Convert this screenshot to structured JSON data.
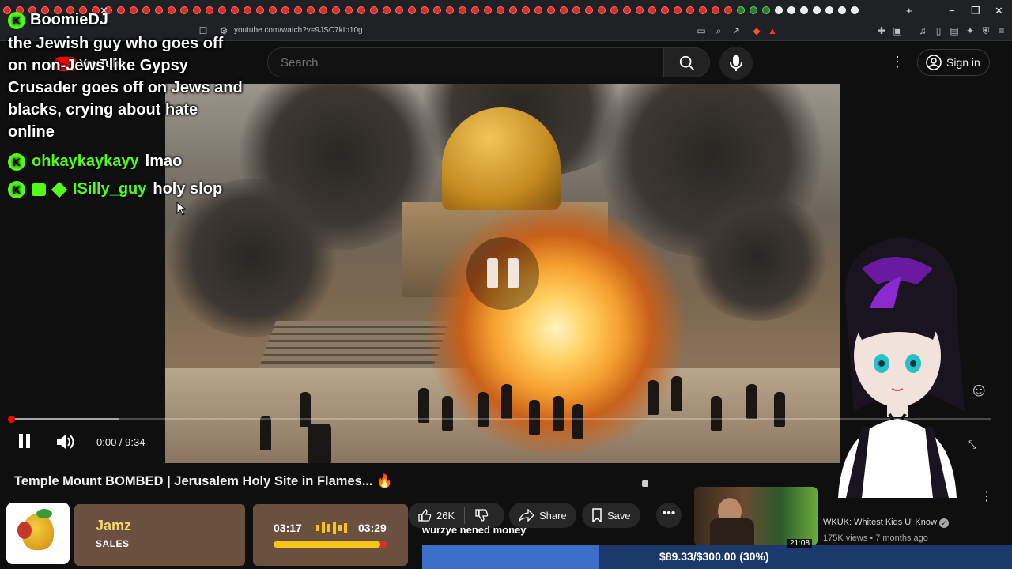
{
  "browser": {
    "url": "youtube.com/watch?v=9JSC7kIp10g",
    "close_tab": "✕",
    "new_tab": "+",
    "window_controls": {
      "minimize": "−",
      "maximize": "❐",
      "close": "✕"
    }
  },
  "youtube": {
    "logo_text": "YouTube",
    "search": {
      "placeholder": "Search"
    },
    "signin_label": "Sign in",
    "video": {
      "title": "Temple Mount BOMBED | Jerusalem Holy Site in Flames... 🔥",
      "time_display": "0:00 / 9:34",
      "progress_fraction": 0.0,
      "state": "paused"
    },
    "actions": {
      "likes": "26K",
      "share_label": "Share",
      "save_label": "Save"
    },
    "recommendation": {
      "title": "WKUK: Whitest Kids U' Know",
      "meta": "175K views • 7 months ago",
      "duration": "21:08"
    }
  },
  "stream_overlay": {
    "streamer_name": "BoomieDJ",
    "chat": {
      "top_message": "the Jewish guy who goes off on non-Jews like Gypsy Crusader goes off on Jews and blacks, crying about hate online",
      "lines": [
        {
          "user": "ohkaykaykayy",
          "message": "lmao"
        },
        {
          "user": "ISilly_guy",
          "message": "holy slop"
        }
      ]
    },
    "music": {
      "artist": "Jamz",
      "label": "SALES",
      "elapsed": "03:17",
      "total": "03:29",
      "progress_fraction": 0.94
    },
    "donation": {
      "message": "wurzye nened money",
      "goal_text": "$89.33/$300.00 (30%)",
      "goal_fraction": 0.3
    }
  },
  "colors": {
    "kick_green": "#53fc18",
    "youtube_red": "#ff0000",
    "link_blue": "#3ea6ff"
  }
}
